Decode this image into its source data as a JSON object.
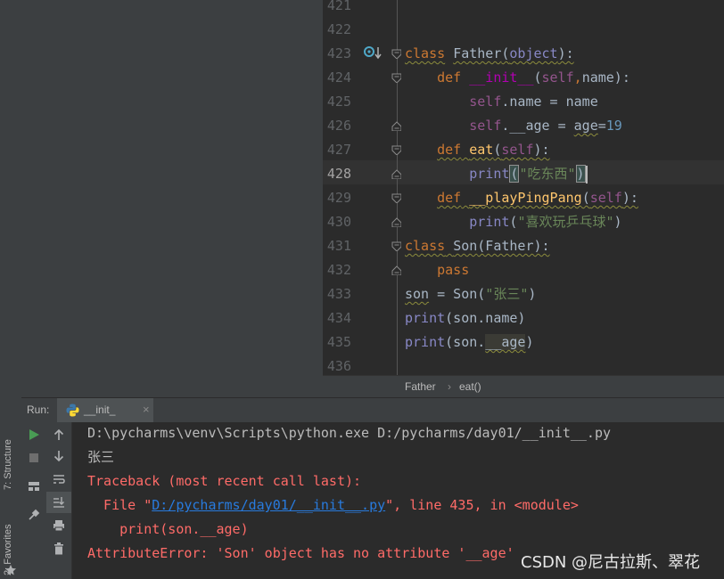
{
  "editor": {
    "line_numbers": [
      "421",
      "422",
      "423",
      "424",
      "425",
      "426",
      "427",
      "428",
      "429",
      "430",
      "431",
      "432",
      "433",
      "434",
      "435",
      "436"
    ],
    "current_line": "428",
    "code": [
      {
        "segments": []
      },
      {
        "segments": []
      },
      {
        "segments": [
          {
            "t": "class",
            "c": "kw squig"
          },
          {
            "t": " ",
            "c": ""
          },
          {
            "t": "Father",
            "c": "squig"
          },
          {
            "t": "(",
            "c": "squig"
          },
          {
            "t": "object",
            "c": "builtin squig"
          },
          {
            "t": "):",
            "c": "squig"
          }
        ]
      },
      {
        "segments": [
          {
            "t": "    def ",
            "c": "kw"
          },
          {
            "t": "__init__",
            "c": "dunder"
          },
          {
            "t": "(",
            "c": ""
          },
          {
            "t": "self",
            "c": "self"
          },
          {
            "t": ",",
            "c": "kw"
          },
          {
            "t": "name):",
            "c": ""
          }
        ]
      },
      {
        "segments": [
          {
            "t": "        ",
            "c": ""
          },
          {
            "t": "self",
            "c": "self"
          },
          {
            "t": ".name = name",
            "c": ""
          }
        ]
      },
      {
        "segments": [
          {
            "t": "        ",
            "c": ""
          },
          {
            "t": "self",
            "c": "self"
          },
          {
            "t": ".__age = ",
            "c": ""
          },
          {
            "t": "age",
            "c": "squig"
          },
          {
            "t": "=",
            "c": ""
          },
          {
            "t": "19",
            "c": "num"
          }
        ]
      },
      {
        "segments": [
          {
            "t": "    ",
            "c": ""
          },
          {
            "t": "def",
            "c": "kw squig"
          },
          {
            "t": " ",
            "c": "squig"
          },
          {
            "t": "eat",
            "c": "fn squig"
          },
          {
            "t": "(",
            "c": "squig"
          },
          {
            "t": "self",
            "c": "self squig"
          },
          {
            "t": "):",
            "c": "squig"
          }
        ]
      },
      {
        "segments": [
          {
            "t": "        ",
            "c": ""
          },
          {
            "t": "print",
            "c": "builtin"
          },
          {
            "t": "(",
            "c": "bracket"
          },
          {
            "t": "\"吃东西\"",
            "c": "str"
          },
          {
            "t": ")",
            "c": "bracket"
          },
          {
            "t": "",
            "c": "caret"
          }
        ]
      },
      {
        "segments": [
          {
            "t": "    ",
            "c": ""
          },
          {
            "t": "def",
            "c": "kw squig"
          },
          {
            "t": " ",
            "c": "squig"
          },
          {
            "t": "__playPingPang",
            "c": "fn squig"
          },
          {
            "t": "(",
            "c": "squig"
          },
          {
            "t": "self",
            "c": "self squig"
          },
          {
            "t": "):",
            "c": "squig"
          }
        ]
      },
      {
        "segments": [
          {
            "t": "        ",
            "c": ""
          },
          {
            "t": "print",
            "c": "builtin"
          },
          {
            "t": "(",
            "c": ""
          },
          {
            "t": "\"喜欢玩乒乓球\"",
            "c": "str"
          },
          {
            "t": ")",
            "c": ""
          }
        ]
      },
      {
        "segments": [
          {
            "t": "class",
            "c": "kw squig"
          },
          {
            "t": " ",
            "c": "squig"
          },
          {
            "t": "Son",
            "c": "squig"
          },
          {
            "t": "(Father):",
            "c": "squig"
          }
        ]
      },
      {
        "segments": [
          {
            "t": "    pass",
            "c": "kw"
          }
        ]
      },
      {
        "segments": [
          {
            "t": "son",
            "c": "squig"
          },
          {
            "t": " = Son(",
            "c": ""
          },
          {
            "t": "\"张三\"",
            "c": "str"
          },
          {
            "t": ")",
            "c": ""
          }
        ]
      },
      {
        "segments": [
          {
            "t": "print",
            "c": "builtin"
          },
          {
            "t": "(son.name)",
            "c": ""
          }
        ]
      },
      {
        "segments": [
          {
            "t": "print",
            "c": "builtin"
          },
          {
            "t": "(son.",
            "c": ""
          },
          {
            "t": "__age",
            "c": "hl-age squig"
          },
          {
            "t": ")",
            "c": ""
          }
        ]
      },
      {
        "segments": []
      }
    ],
    "fold_markers": [
      {
        "line": "423",
        "kind": "open"
      },
      {
        "line": "424",
        "kind": "open"
      },
      {
        "line": "426",
        "kind": "close"
      },
      {
        "line": "427",
        "kind": "open"
      },
      {
        "line": "428",
        "kind": "close"
      },
      {
        "line": "429",
        "kind": "open"
      },
      {
        "line": "430",
        "kind": "close"
      },
      {
        "line": "431",
        "kind": "open"
      },
      {
        "line": "432",
        "kind": "close"
      }
    ]
  },
  "breadcrumb": {
    "items": [
      "Father",
      "eat()"
    ]
  },
  "run_panel": {
    "label": "Run:",
    "tab_label": "__init_",
    "tab_close": "×"
  },
  "side_tabs": {
    "structure": "7: Structure",
    "favorites": "2: Favorites"
  },
  "console": {
    "lines": [
      {
        "segments": [
          {
            "t": "D:\\pycharms\\venv\\Scripts\\python.exe D:/pycharms/day01/__init__.py",
            "c": "con-normal"
          }
        ]
      },
      {
        "segments": [
          {
            "t": "张三",
            "c": "con-normal"
          }
        ]
      },
      {
        "segments": [
          {
            "t": "Traceback (most recent call last):",
            "c": "con-err"
          }
        ]
      },
      {
        "segments": [
          {
            "t": "  File \"",
            "c": "con-err"
          },
          {
            "t": "D:/pycharms/day01/__init__.py",
            "c": "con-link"
          },
          {
            "t": "\", line 435, in <module>",
            "c": "con-err"
          }
        ]
      },
      {
        "segments": [
          {
            "t": "    print(son.__age)",
            "c": "con-err"
          }
        ]
      },
      {
        "segments": [
          {
            "t": "AttributeError: 'Son' object has no attribute '__age'",
            "c": "con-err"
          }
        ]
      }
    ]
  },
  "watermark": "CSDN @尼古拉斯、翠花",
  "colors": {
    "accent": "#cc7832",
    "error": "#ff6b68",
    "link": "#287bde"
  }
}
